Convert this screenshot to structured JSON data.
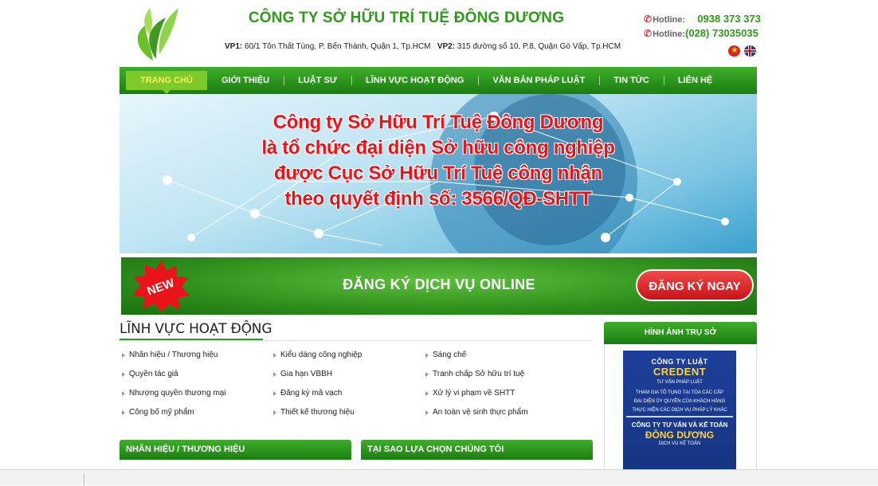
{
  "header": {
    "company_title": "CÔNG TY SỞ HỮU TRÍ TUỆ ĐÔNG DƯƠNG",
    "vp1_label": "VP1:",
    "vp1_address": " 60/1 Tôn Thất Tùng, P. Bến Thành, Quận 1,  Tp.HCM",
    "vp2_label": "VP2:",
    "vp2_address": " 315 đường số 10, P.8, Quận Gò Vấp, Tp.HCM",
    "hotline1_label": "Hotline:",
    "hotline1_number": "0938 373 373",
    "hotline2_label": "Hotline:",
    "hotline2_number": "(028) 73035035",
    "icons": {
      "phone": "phone-icon",
      "logo": "leaf-logo",
      "flag_vn": "vietnam-flag-icon",
      "flag_uk": "uk-flag-icon"
    }
  },
  "nav": {
    "items": [
      {
        "label": "TRANG CHỦ",
        "active": true
      },
      {
        "label": "GIỚI THIỆU"
      },
      {
        "label": "LUẬT SƯ"
      },
      {
        "label": "LĨNH VỰC HOẠT ĐỘNG"
      },
      {
        "label": "VĂN BẢN PHÁP LUẬT"
      },
      {
        "label": "TIN TỨC"
      },
      {
        "label": "LIÊN HỆ"
      }
    ]
  },
  "banner": {
    "lines": [
      "Công ty Sở Hữu Trí Tuệ Đông Dương",
      "là tổ chức đại diện Sở hữu công nghiệp",
      "được Cục Sở Hữu Trí Tuệ công nhận",
      "theo quyết định số: 3566/QĐ-SHTT"
    ]
  },
  "register": {
    "badge": "NEW",
    "text": "ĐĂNG KÝ DỊCH VỤ ONLINE",
    "button": "ĐĂNG KÝ NGAY"
  },
  "fields": {
    "title": "LĨNH VỰC HOẠT ĐỘNG",
    "items": [
      "Nhãn hiệu / Thương hiệu",
      "Kiểu dáng công nghiệp",
      "Sáng chế",
      "Quyền tác giả",
      "Gia hạn VBBH",
      "Tranh chấp Sở hữu trí tuệ",
      "Nhượng quyền thương mại",
      "Đăng ký mã vạch",
      "Xử lý vi phạm về SHTT",
      "Công bố mỹ phẩm",
      "Thiết kế thương hiệu",
      "An toàn vệ sinh thực phẩm"
    ]
  },
  "panels": {
    "left": "NHÃN HIỆU / THƯƠNG HIỆU",
    "middle": "TẠI SAO LỰA CHỌN CHÚNG TÔI",
    "right": "HÌNH ẢNH TRỤ SỞ"
  },
  "office_sign": {
    "line1": "CÔNG TY LUẬT",
    "line2": "CREDENT",
    "line3": "TƯ VẤN PHÁP LUẬT",
    "line4": "THAM GIA TỐ TỤNG TẠI TÒA CÁC CẤP",
    "line5": "ĐẠI DIỆN ỦY QUYỀN CỦA KHÁCH HÀNG",
    "line6": "THỰC HIỆN CÁC DỊCH VỤ PHÁP LÝ KHÁC",
    "line7": "CÔNG TY TƯ VẤN VÀ KẾ TOÁN",
    "line8": "ĐÔNG DƯƠNG",
    "line9": "DỊCH VỤ KẾ TOÁN"
  },
  "colors": {
    "brand_green": "#2e9a1c",
    "accent_red": "#e8141a",
    "sign_blue": "#1d3f9a"
  }
}
